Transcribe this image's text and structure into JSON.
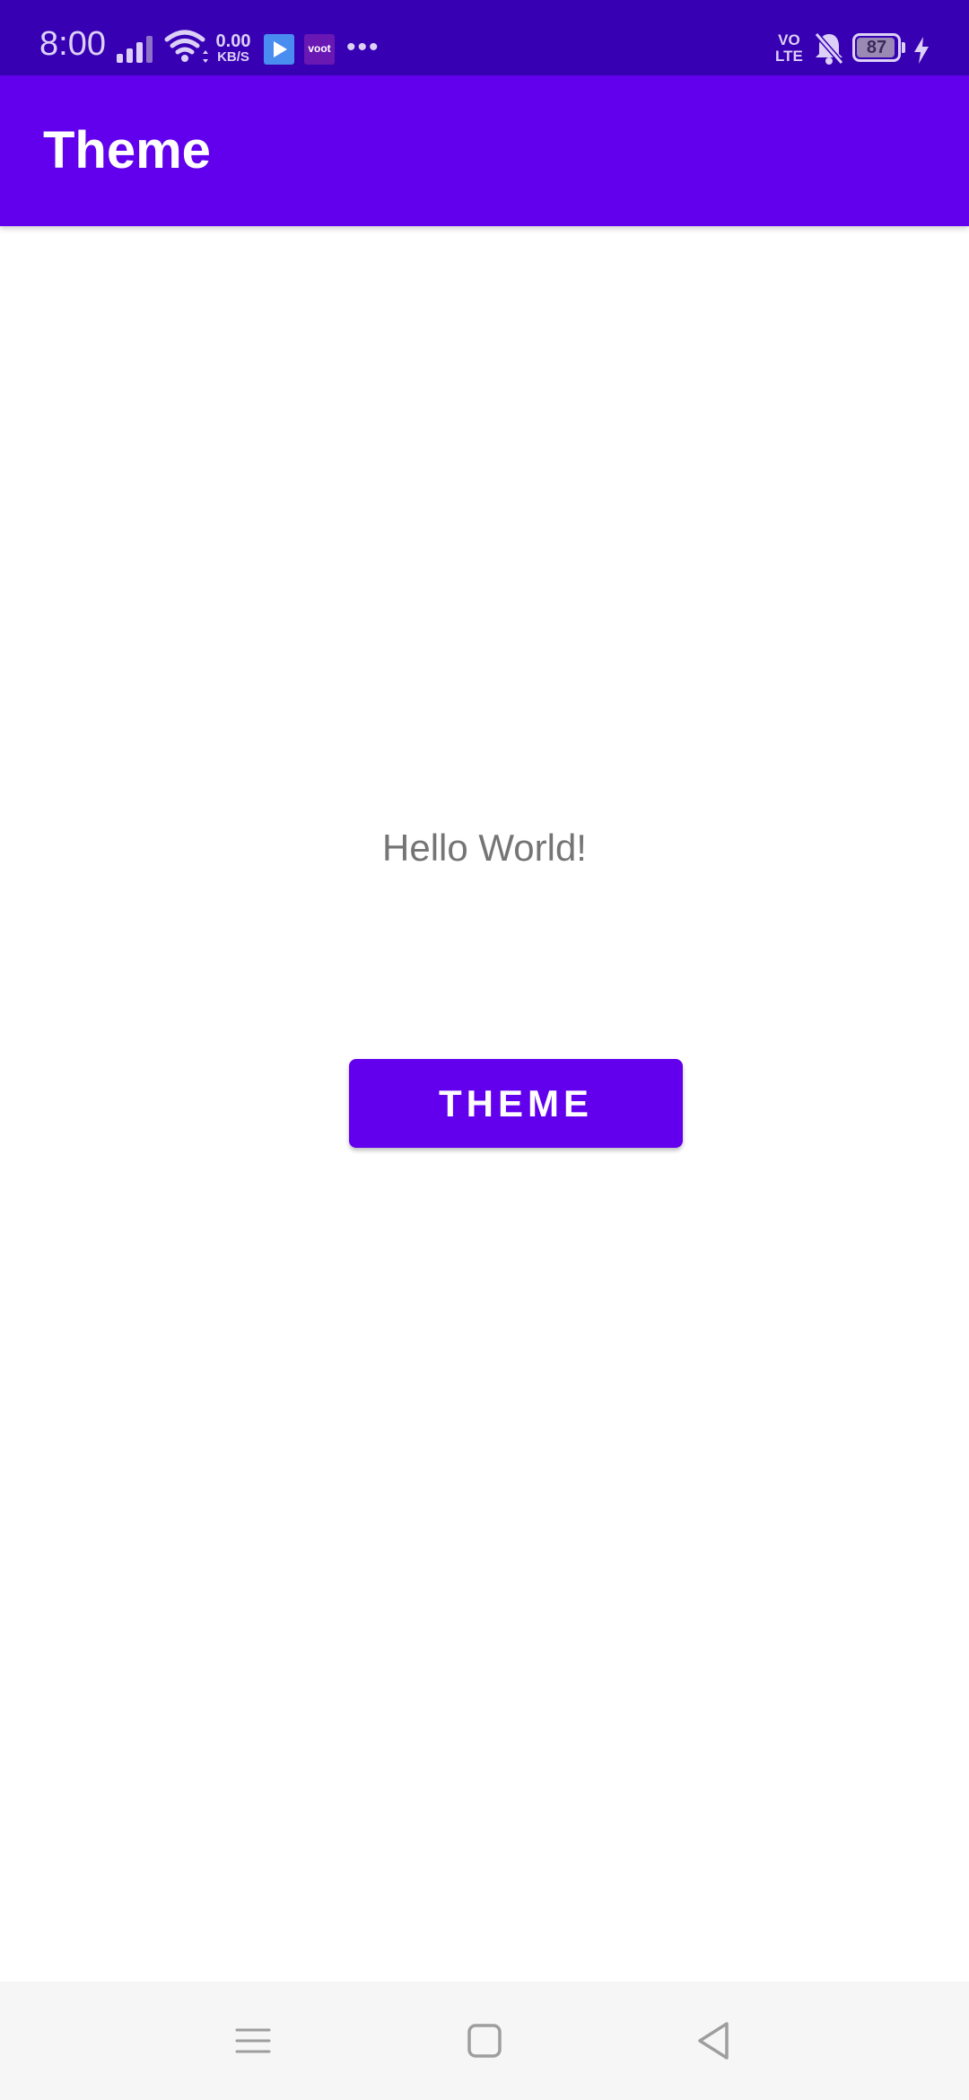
{
  "status_bar": {
    "time": "8:00",
    "net_rate": "0.00",
    "net_unit": "KB/S",
    "voot_label": "voot",
    "volte_top": "VO",
    "volte_bottom": "LTE",
    "battery_level": "87",
    "icons": [
      "signal-icon",
      "wifi-icon",
      "play-store-icon",
      "voot-app-icon",
      "more-notifications-icon",
      "volte-icon",
      "bell-muted-icon",
      "battery-icon",
      "charging-icon"
    ]
  },
  "app_bar": {
    "title": "Theme"
  },
  "main": {
    "hello_text": "Hello World!",
    "theme_button_label": "THEME"
  },
  "nav_bar": {
    "icons": [
      "menu-icon",
      "home-icon",
      "back-icon"
    ]
  },
  "colors": {
    "status_bar": "#3700b3",
    "primary": "#6200ee",
    "text_secondary": "#757575",
    "nav_bar": "#f6f6f6"
  }
}
